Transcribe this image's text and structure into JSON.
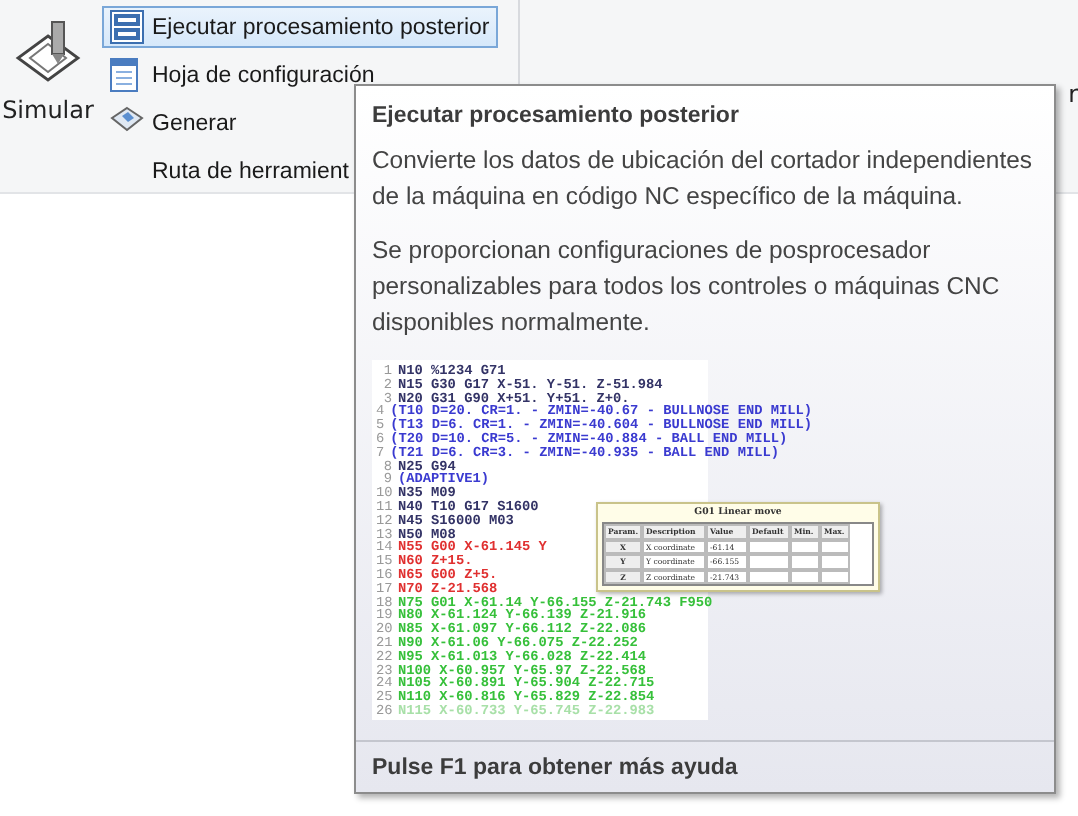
{
  "ribbon": {
    "simulate_button": {
      "label": "Simular"
    },
    "menu_items": [
      {
        "label": "Ejecutar procesamiento posterior",
        "kind": "post",
        "selected": true
      },
      {
        "label": "Hoja de configuración",
        "kind": "sheet",
        "selected": false
      },
      {
        "label": "Generar",
        "kind": "generate",
        "selected": false
      },
      {
        "label": "Ruta de herramient",
        "kind": "none",
        "selected": false
      }
    ],
    "cut_label": "r"
  },
  "tooltip": {
    "title": "Ejecutar procesamiento posterior",
    "paragraphs": [
      "Convierte los datos de ubicación del cortador independientes de la máquina en código NC específico de la máquina.",
      "Se proporcionan configuraciones de posprocesador personalizables para todos los controles o máquinas CNC disponibles normalmente."
    ],
    "preview": {
      "lines": [
        {
          "number": "1",
          "text": "N10 %1234 G71",
          "kind": "code"
        },
        {
          "number": "2",
          "text": "N15 G30 G17 X-51. Y-51. Z-51.984",
          "kind": "code"
        },
        {
          "number": "3",
          "text": "N20 G31 G90 X+51. Y+51. Z+0.",
          "kind": "code"
        },
        {
          "number": "4",
          "text": "(T10  D=20. CR=1. - ZMIN=-40.67 - BULLNOSE END MILL)",
          "kind": "comment"
        },
        {
          "number": "5",
          "text": "(T13  D=6. CR=1. - ZMIN=-40.604 - BULLNOSE END MILL)",
          "kind": "comment"
        },
        {
          "number": "6",
          "text": "(T20  D=10. CR=5. - ZMIN=-40.884 - BALL END MILL)",
          "kind": "comment"
        },
        {
          "number": "7",
          "text": "(T21  D=6. CR=3. - ZMIN=-40.935 - BALL END MILL)",
          "kind": "comment"
        },
        {
          "number": "8",
          "text": "N25 G94",
          "kind": "code"
        },
        {
          "number": "9",
          "text": "(ADAPTIVE1)",
          "kind": "comment"
        },
        {
          "number": "10",
          "text": "N35 M09",
          "kind": "code"
        },
        {
          "number": "11",
          "text": "N40 T10 G17 S1600",
          "kind": "code"
        },
        {
          "number": "12",
          "text": "N45 S16000 M03",
          "kind": "code"
        },
        {
          "number": "13",
          "text": "N50 M08",
          "kind": "code"
        },
        {
          "number": "14",
          "text": "N55 G00 X-61.145 Y",
          "kind": "rapid"
        },
        {
          "number": "15",
          "text": "N60 Z+15.",
          "kind": "rapid"
        },
        {
          "number": "16",
          "text": "N65 G00 Z+5.",
          "kind": "rapid"
        },
        {
          "number": "17",
          "text": "N70 Z-21.568",
          "kind": "rapid"
        },
        {
          "number": "18",
          "text": "N75 G01 X-61.14 Y-66.155 Z-21.743 F950",
          "kind": "feed"
        },
        {
          "number": "19",
          "text": "N80 X-61.124 Y-66.139 Z-21.916",
          "kind": "feed"
        },
        {
          "number": "20",
          "text": "N85 X-61.097 Y-66.112 Z-22.086",
          "kind": "feed"
        },
        {
          "number": "21",
          "text": "N90 X-61.06 Y-66.075 Z-22.252",
          "kind": "feed"
        },
        {
          "number": "22",
          "text": "N95 X-61.013 Y-66.028 Z-22.414",
          "kind": "feed"
        },
        {
          "number": "23",
          "text": "N100 X-60.957 Y-65.97 Z-22.568",
          "kind": "feed"
        },
        {
          "number": "24",
          "text": "N105 X-60.891 Y-65.904 Z-22.715",
          "kind": "feed"
        },
        {
          "number": "25",
          "text": "N110 X-60.816 Y-65.829 Z-22.854",
          "kind": "feed"
        },
        {
          "number": "26",
          "text": "N115 X-60.733 Y-65.745 Z-22.983",
          "kind": "faded"
        }
      ],
      "callout": {
        "title": "G01 Linear move",
        "columns": [
          "Param.",
          "Description",
          "Value",
          "Default",
          "Min.",
          "Max."
        ],
        "rows": [
          [
            "X",
            "X coordinate",
            "-61.14",
            "",
            "",
            ""
          ],
          [
            "Y",
            "Y coordinate",
            "-66.155",
            "",
            "",
            ""
          ],
          [
            "Z",
            "Z coordinate",
            "-21.743",
            "",
            "",
            ""
          ]
        ]
      }
    },
    "footer": "Pulse F1 para obtener más ayuda"
  }
}
